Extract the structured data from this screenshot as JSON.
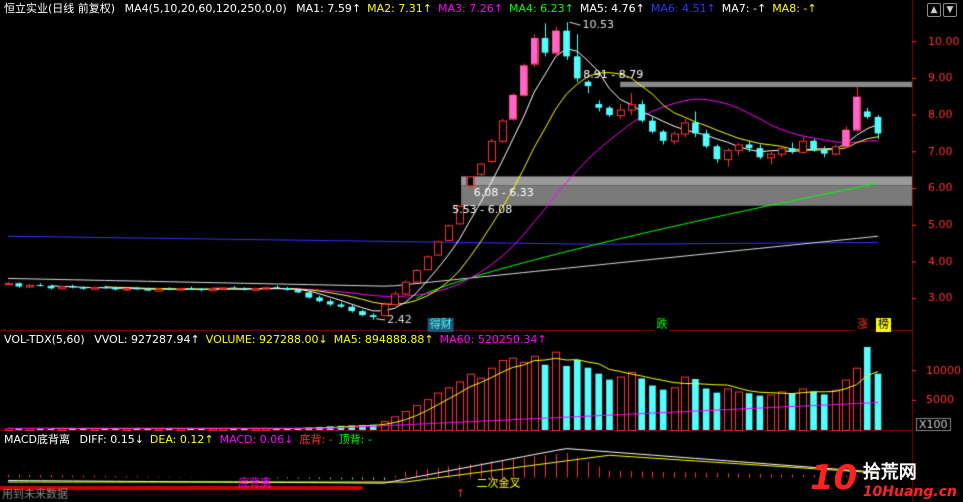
{
  "header": {
    "stock_name": "恒立实业(日线 前复权)",
    "ma_params": "MA4(5,10,20,60,120,250,0,0)",
    "ma_items": [
      {
        "label": "MA1: 7.59",
        "color": "#ffffff"
      },
      {
        "label": "MA2: 7.31",
        "color": "#ffff00"
      },
      {
        "label": "MA3: 7.26",
        "color": "#ff00ff"
      },
      {
        "label": "MA4: 6.23",
        "color": "#00ff00"
      },
      {
        "label": "MA5: 4.76",
        "color": "#ffffff"
      },
      {
        "label": "MA6: 4.51",
        "color": "#3333ff"
      },
      {
        "label": "MA7: -",
        "color": "#ffffff"
      },
      {
        "label": "MA8: -",
        "color": "#ffff00"
      }
    ],
    "arrow": "↑"
  },
  "volume_header": {
    "title": "VOL-TDX(5,60)",
    "items": [
      {
        "label": "VVOL: 927287.94",
        "color": "#ffffff",
        "arrow": "↑"
      },
      {
        "label": "VOLUME: 927288.00",
        "color": "#ffff00",
        "arrow": "↓"
      },
      {
        "label": "MA5: 894888.88",
        "color": "#ffff00",
        "arrow": "↑"
      },
      {
        "label": "MA60: 520250.34",
        "color": "#ff00ff",
        "arrow": "↑"
      }
    ]
  },
  "macd_header": {
    "title": "MACD底背离",
    "items": [
      {
        "label": "DIFF: 0.15",
        "color": "#ffffff",
        "arrow": "↓"
      },
      {
        "label": "DEA: 0.12",
        "color": "#ffff00",
        "arrow": "↑"
      },
      {
        "label": "MACD: 0.06",
        "color": "#ff00ff",
        "arrow": "↓"
      },
      {
        "label": "底背: -",
        "color": "#ff3333",
        "arrow": ""
      },
      {
        "label": "顶背: -",
        "color": "#00ff00",
        "arrow": ""
      }
    ]
  },
  "nav": {
    "up": "▲",
    "down": "▼"
  },
  "annotations": {
    "high": "10.53",
    "low": "2.42",
    "box1": "8.91 - 8.79",
    "box2": "6.08 - 6.33",
    "box3": "5.53 - 6.08",
    "tag_finance": "得财",
    "tag_fall": "跌",
    "tag_rise": "涨",
    "tag_list": "榜",
    "macd_bottom_div": "底背离",
    "macd_golden_cross": "二次金叉",
    "footer_text": "用到未来数据",
    "vol_unit": "X100"
  },
  "colors": {
    "up": "#ff3232",
    "down": "#54ffff",
    "grid": "#8b0000",
    "axis_text": "#ff3232"
  },
  "watermark": {
    "brand_num": "10",
    "brand_cn": "拾荒网",
    "url": "10Huang.cn"
  },
  "chart_data": [
    {
      "type": "candlestick",
      "title": "恒立实业(日线 前复权)",
      "y_ticks": [
        "3.00",
        "4.00",
        "5.00",
        "6.00",
        "7.00",
        "8.00",
        "9.00",
        "10.00"
      ],
      "ylim": [
        2.2,
        10.7
      ],
      "candles": [
        [
          3.4,
          3.45,
          3.38,
          3.42
        ],
        [
          3.42,
          3.44,
          3.3,
          3.33
        ],
        [
          3.33,
          3.4,
          3.3,
          3.37
        ],
        [
          3.37,
          3.42,
          3.33,
          3.35
        ],
        [
          3.35,
          3.38,
          3.25,
          3.28
        ],
        [
          3.28,
          3.36,
          3.25,
          3.33
        ],
        [
          3.33,
          3.38,
          3.28,
          3.3
        ],
        [
          3.3,
          3.34,
          3.24,
          3.27
        ],
        [
          3.27,
          3.33,
          3.24,
          3.31
        ],
        [
          3.31,
          3.35,
          3.27,
          3.29
        ],
        [
          3.29,
          3.33,
          3.22,
          3.25
        ],
        [
          3.25,
          3.3,
          3.21,
          3.28
        ],
        [
          3.28,
          3.32,
          3.24,
          3.26
        ],
        [
          3.26,
          3.3,
          3.2,
          3.22
        ],
        [
          3.22,
          3.29,
          3.2,
          3.27
        ],
        [
          3.27,
          3.31,
          3.23,
          3.25
        ],
        [
          3.25,
          3.3,
          3.22,
          3.28
        ],
        [
          3.28,
          3.33,
          3.25,
          3.26
        ],
        [
          3.26,
          3.29,
          3.2,
          3.23
        ],
        [
          3.23,
          3.28,
          3.21,
          3.27
        ],
        [
          3.27,
          3.32,
          3.24,
          3.3
        ],
        [
          3.3,
          3.34,
          3.26,
          3.27
        ],
        [
          3.27,
          3.31,
          3.22,
          3.24
        ],
        [
          3.24,
          3.3,
          3.21,
          3.28
        ],
        [
          3.28,
          3.33,
          3.25,
          3.31
        ],
        [
          3.31,
          3.36,
          3.28,
          3.29
        ],
        [
          3.29,
          3.32,
          3.22,
          3.24
        ],
        [
          3.24,
          3.27,
          3.15,
          3.17
        ],
        [
          3.17,
          3.2,
          3.0,
          3.03
        ],
        [
          3.03,
          3.08,
          2.9,
          2.93
        ],
        [
          2.93,
          2.98,
          2.8,
          2.84
        ],
        [
          2.84,
          2.9,
          2.75,
          2.78
        ],
        [
          2.78,
          2.82,
          2.62,
          2.66
        ],
        [
          2.66,
          2.7,
          2.52,
          2.55
        ],
        [
          2.55,
          2.6,
          2.42,
          2.5
        ],
        [
          2.55,
          2.9,
          2.52,
          2.85
        ],
        [
          2.85,
          3.2,
          2.82,
          3.14
        ],
        [
          3.14,
          3.5,
          3.1,
          3.46
        ],
        [
          3.46,
          3.8,
          3.42,
          3.78
        ],
        [
          3.8,
          4.18,
          3.78,
          4.15
        ],
        [
          4.2,
          4.58,
          4.18,
          4.56
        ],
        [
          4.6,
          5.02,
          4.58,
          5.0
        ],
        [
          5.05,
          5.55,
          5.03,
          5.53
        ],
        [
          6.08,
          6.33,
          6.0,
          6.33
        ],
        [
          6.4,
          6.7,
          6.35,
          6.68
        ],
        [
          6.75,
          7.35,
          6.7,
          7.3
        ],
        [
          7.3,
          7.9,
          7.25,
          7.85
        ],
        [
          7.9,
          8.6,
          7.85,
          8.55
        ],
        [
          8.55,
          9.4,
          8.5,
          9.35
        ],
        [
          9.4,
          10.2,
          9.3,
          10.1
        ],
        [
          10.1,
          10.5,
          9.6,
          9.7
        ],
        [
          9.7,
          10.4,
          9.6,
          10.3
        ],
        [
          10.3,
          10.53,
          9.5,
          9.6
        ],
        [
          9.6,
          10.2,
          8.9,
          9.0
        ],
        [
          8.91,
          8.95,
          8.6,
          8.79
        ],
        [
          8.3,
          8.4,
          8.1,
          8.2
        ],
        [
          8.2,
          8.25,
          7.95,
          8.0
        ],
        [
          8.0,
          8.3,
          7.9,
          8.15
        ],
        [
          8.15,
          8.6,
          8.0,
          8.3
        ],
        [
          8.3,
          8.4,
          7.8,
          7.85
        ],
        [
          7.85,
          7.95,
          7.5,
          7.55
        ],
        [
          7.55,
          7.6,
          7.2,
          7.3
        ],
        [
          7.3,
          7.55,
          7.2,
          7.5
        ],
        [
          7.5,
          7.9,
          7.4,
          7.8
        ],
        [
          7.8,
          8.1,
          7.4,
          7.5
        ],
        [
          7.5,
          7.6,
          7.1,
          7.15
        ],
        [
          7.15,
          7.2,
          6.7,
          6.8
        ],
        [
          6.8,
          7.1,
          6.6,
          7.05
        ],
        [
          7.05,
          7.25,
          6.9,
          7.2
        ],
        [
          7.2,
          7.3,
          7.0,
          7.1
        ],
        [
          7.1,
          7.2,
          6.8,
          6.85
        ],
        [
          6.85,
          7.0,
          6.65,
          6.95
        ],
        [
          6.95,
          7.15,
          6.85,
          7.1
        ],
        [
          7.1,
          7.25,
          6.95,
          7.0
        ],
        [
          7.0,
          7.4,
          6.95,
          7.3
        ],
        [
          7.3,
          7.35,
          7.0,
          7.05
        ],
        [
          7.05,
          7.15,
          6.85,
          6.95
        ],
        [
          6.95,
          7.2,
          6.9,
          7.15
        ],
        [
          7.15,
          7.7,
          7.1,
          7.6
        ],
        [
          7.6,
          8.8,
          7.55,
          8.5
        ],
        [
          8.1,
          8.2,
          7.9,
          7.95
        ],
        [
          7.95,
          8.0,
          7.35,
          7.5
        ]
      ],
      "ma_lines": [
        {
          "name": "MA1",
          "color": "#ffffff"
        },
        {
          "name": "MA2",
          "color": "#ffff00"
        },
        {
          "name": "MA3",
          "color": "#ff00ff"
        },
        {
          "name": "MA4",
          "color": "#00ff00"
        },
        {
          "name": "MA5",
          "color": "#dddddd"
        },
        {
          "name": "MA6",
          "color": "#3333ff"
        }
      ],
      "price_boxes": [
        [
          8.79,
          8.91
        ],
        [
          6.08,
          6.33
        ],
        [
          5.53,
          6.08
        ]
      ]
    },
    {
      "type": "bar",
      "title": "VOL-TDX(5,60)",
      "y_ticks": [
        "5000",
        "10000"
      ],
      "ylim": [
        0,
        14500
      ],
      "values": [
        300,
        260,
        280,
        250,
        230,
        260,
        240,
        250,
        270,
        240,
        230,
        260,
        250,
        240,
        260,
        250,
        270,
        240,
        230,
        260,
        280,
        250,
        240,
        260,
        270,
        250,
        240,
        300,
        420,
        520,
        620,
        700,
        780,
        820,
        900,
        1500,
        2300,
        3200,
        4200,
        5200,
        6300,
        7200,
        8200,
        9500,
        8800,
        10500,
        11800,
        12200,
        11500,
        12500,
        11000,
        13200,
        10800,
        11800,
        10500,
        9500,
        8500,
        9000,
        9800,
        8700,
        7500,
        6800,
        7200,
        9000,
        8600,
        7000,
        6300,
        7000,
        6500,
        6200,
        5800,
        6000,
        6500,
        6200,
        7000,
        6500,
        6000,
        6800,
        8500,
        10500,
        14000,
        9500
      ],
      "ma_lines": [
        {
          "name": "MA5",
          "color": "#ffff00"
        },
        {
          "name": "MA60",
          "color": "#ff00ff"
        }
      ]
    },
    {
      "type": "bar",
      "title": "MACD底背离",
      "ylim": [
        -0.55,
        0.85
      ],
      "diff_line_color": "#ffffff",
      "dea_line_color": "#ffff00"
    }
  ]
}
